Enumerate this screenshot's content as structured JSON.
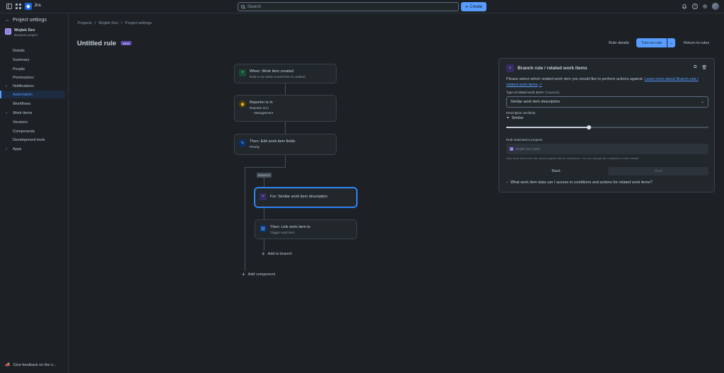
{
  "topbar": {
    "app_name": "Jira",
    "search_placeholder": "Search",
    "create_label": "Create"
  },
  "sidebar": {
    "back_label": "Project settings",
    "project_name": "Wojtek Dev",
    "project_type": "Business project",
    "items": [
      {
        "label": "Details",
        "expandable": false,
        "active": false
      },
      {
        "label": "Summary",
        "expandable": false,
        "active": false
      },
      {
        "label": "People",
        "expandable": false,
        "active": false
      },
      {
        "label": "Permissions",
        "expandable": false,
        "active": false
      },
      {
        "label": "Notifications",
        "expandable": true,
        "active": false
      },
      {
        "label": "Automation",
        "expandable": false,
        "active": true
      },
      {
        "label": "Workflows",
        "expandable": false,
        "active": false
      },
      {
        "label": "Work items",
        "expandable": true,
        "active": false
      },
      {
        "label": "Versions",
        "expandable": false,
        "active": false
      },
      {
        "label": "Components",
        "expandable": false,
        "active": false
      },
      {
        "label": "Development tools",
        "expandable": false,
        "active": false
      },
      {
        "label": "Apps",
        "expandable": true,
        "active": false
      }
    ],
    "feedback_label": "Give feedback on the n..."
  },
  "breadcrumb": [
    "Projects",
    "/",
    "Wojtek Dev",
    "/",
    "Project settings"
  ],
  "header": {
    "title": "Untitled rule",
    "badge": "NEW",
    "rule_details": "Rule details",
    "turn_on": "Turn on rule",
    "return": "Return to rules"
  },
  "flow": {
    "trigger": {
      "title": "When: Work item created",
      "sub": "Rule is run when a work item is created."
    },
    "condition": {
      "title": "Reporter is in",
      "line2": "Reporter is in",
      "line3": "- Management"
    },
    "action": {
      "title": "Then: Edit work item fields",
      "sub": "Priority"
    },
    "branch_label": "BRANCH",
    "branch_node": {
      "title": "For: Similar work item description"
    },
    "link_node": {
      "title": "Then: Link work item to",
      "sub": "Trigger work item"
    },
    "add_to_branch": "Add to branch",
    "add_component": "Add component"
  },
  "panel": {
    "title": "Branch rule / related work items",
    "desc": "Please select which related work item you would like to perform actions against.",
    "desc_link": "Learn more about Branch rule / related work items",
    "type_label": "Type of related work items",
    "type_required": "* (required)",
    "type_value": "Similar work item description",
    "similarity_label": "Description similarity",
    "similarity_value": "Similar",
    "similarity_level": 0.5,
    "restricted_label": "Rule restricted to projects",
    "restricted_value": "Wojtek Dev (WD)",
    "helper": "Only work items from the above projects will be considered. You can change this restriction in Rule details.",
    "back": "Back",
    "next": "Next",
    "faq": "What work item data can I access in conditions and actions for related work items?"
  },
  "colors": {
    "accent": "#579dff",
    "background": "#1d2125",
    "surface": "#22272b"
  }
}
